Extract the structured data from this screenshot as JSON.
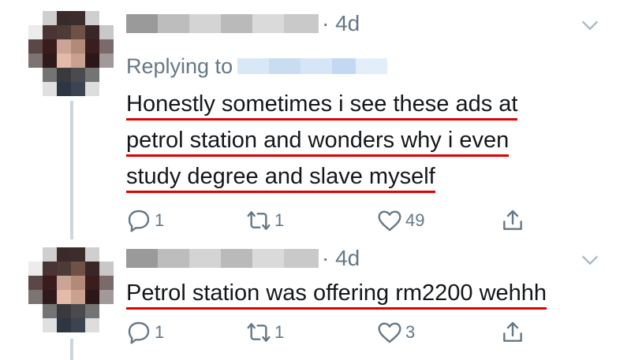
{
  "tweets": [
    {
      "time": "· 4d",
      "replying_to": "Replying to",
      "text_lines": [
        "Honestly sometimes i see these ads at",
        "petrol station and wonders why i even",
        "study degree and slave myself"
      ],
      "replies": "1",
      "retweets": "1",
      "likes": "49"
    },
    {
      "time": "· 4d",
      "text_lines": [
        "Petrol station was offering rm2200 wehhh"
      ],
      "replies": "1",
      "retweets": "1",
      "likes": "3"
    }
  ],
  "icons": {
    "reply": "reply-icon",
    "retweet": "retweet-icon",
    "like": "heart-icon",
    "share": "share-icon",
    "more": "chevron-down-icon"
  },
  "colors": {
    "secondary_text": "#657786",
    "underline": "#e00000",
    "thread_line": "#ccd6dd"
  }
}
